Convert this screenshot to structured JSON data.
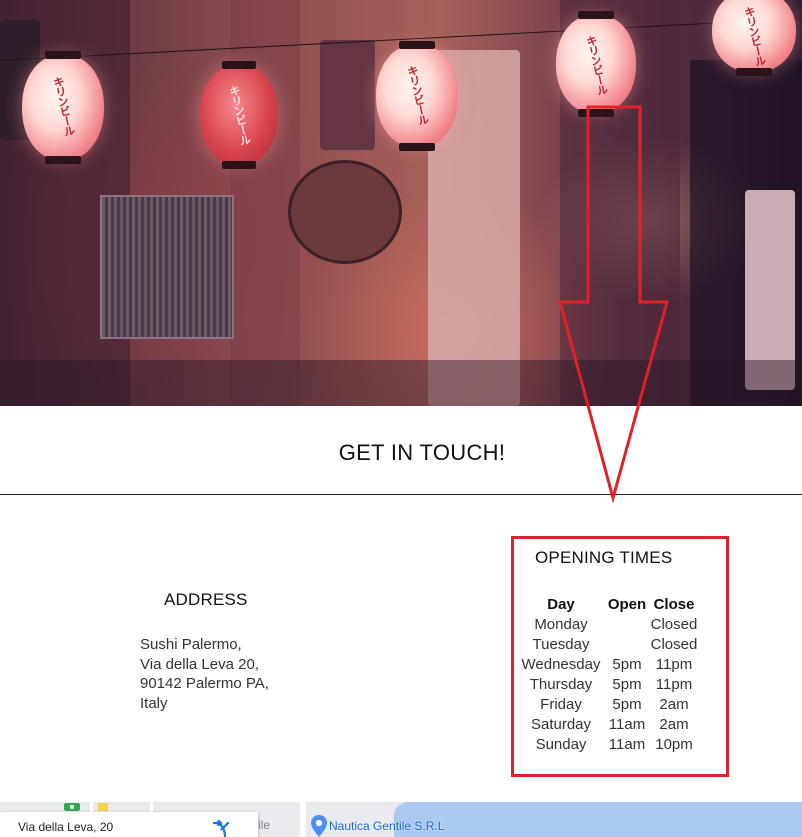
{
  "contact": {
    "section_title": "GET IN TOUCH!",
    "address": {
      "heading": "ADDRESS",
      "lines": [
        "Sushi Palermo,",
        "Via della Leva 20,",
        "90142 Palermo PA,",
        "Italy"
      ]
    },
    "opening_times": {
      "heading": "OPENING TIMES",
      "columns": [
        "Day",
        "Open",
        "Close"
      ],
      "rows": [
        {
          "day": "Monday",
          "open": "",
          "close": "Closed"
        },
        {
          "day": "Tuesday",
          "open": "",
          "close": "Closed"
        },
        {
          "day": "Wednesday",
          "open": "5pm",
          "close": "11pm"
        },
        {
          "day": "Thursday",
          "open": "5pm",
          "close": "11pm"
        },
        {
          "day": "Friday",
          "open": "5pm",
          "close": "2am"
        },
        {
          "day": "Saturday",
          "open": "11am",
          "close": "2am"
        },
        {
          "day": "Sunday",
          "open": "11am",
          "close": "10pm"
        }
      ]
    }
  },
  "hero": {
    "lantern_texts": [
      "キリンビール",
      "キリンビール",
      "キリンビール",
      "キリンビール",
      "キリンビール"
    ]
  },
  "map": {
    "card_title": "Via della Leva, 20",
    "partial_label": "ile",
    "place_label": "Nautica Gentile S.R.L",
    "icons": [
      "directions-icon",
      "place-pin-icon"
    ]
  },
  "colors": {
    "annotation_red": "#e0212a",
    "map_water": "#aac8f0",
    "map_link": "#1967d2"
  }
}
